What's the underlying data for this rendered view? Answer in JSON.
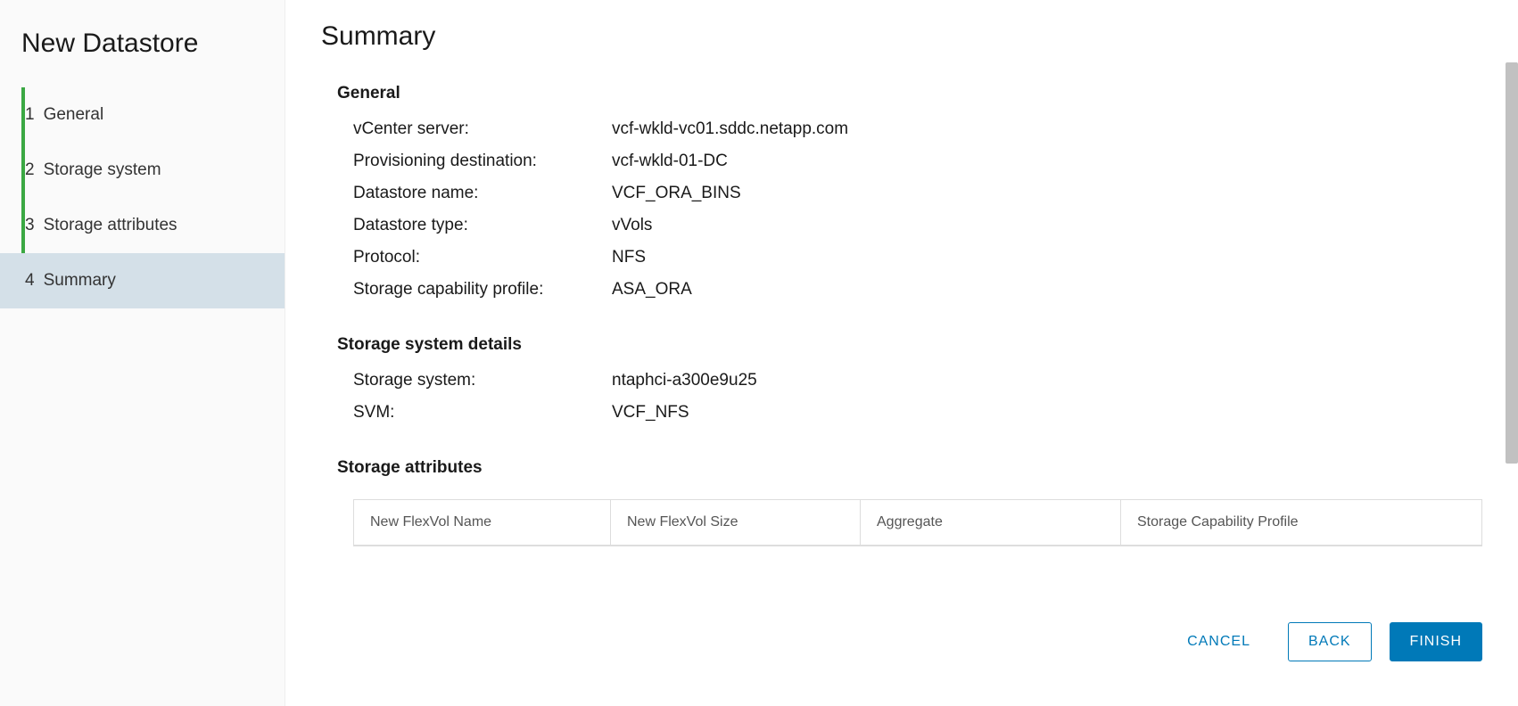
{
  "sidebar": {
    "title": "New Datastore",
    "steps": [
      {
        "num": "1",
        "label": "General"
      },
      {
        "num": "2",
        "label": "Storage system"
      },
      {
        "num": "3",
        "label": "Storage attributes"
      },
      {
        "num": "4",
        "label": "Summary"
      }
    ]
  },
  "main": {
    "title": "Summary",
    "sections": {
      "general": {
        "title": "General",
        "rows": {
          "vcenter": {
            "label": "vCenter server:",
            "value": "vcf-wkld-vc01.sddc.netapp.com"
          },
          "provDest": {
            "label": "Provisioning destination:",
            "value": "vcf-wkld-01-DC"
          },
          "dsName": {
            "label": "Datastore name:",
            "value": "VCF_ORA_BINS"
          },
          "dsType": {
            "label": "Datastore type:",
            "value": "vVols"
          },
          "protocol": {
            "label": "Protocol:",
            "value": "NFS"
          },
          "scp": {
            "label": "Storage capability profile:",
            "value": "ASA_ORA"
          }
        }
      },
      "storageSystem": {
        "title": "Storage system details",
        "rows": {
          "system": {
            "label": "Storage system:",
            "value": "ntaphci-a300e9u25"
          },
          "svm": {
            "label": "SVM:",
            "value": "VCF_NFS"
          }
        }
      },
      "storageAttrs": {
        "title": "Storage attributes",
        "columns": [
          "New FlexVol Name",
          "New FlexVol Size",
          "Aggregate",
          "Storage Capability Profile"
        ]
      }
    }
  },
  "footer": {
    "cancel": "CANCEL",
    "back": "BACK",
    "finish": "FINISH"
  }
}
